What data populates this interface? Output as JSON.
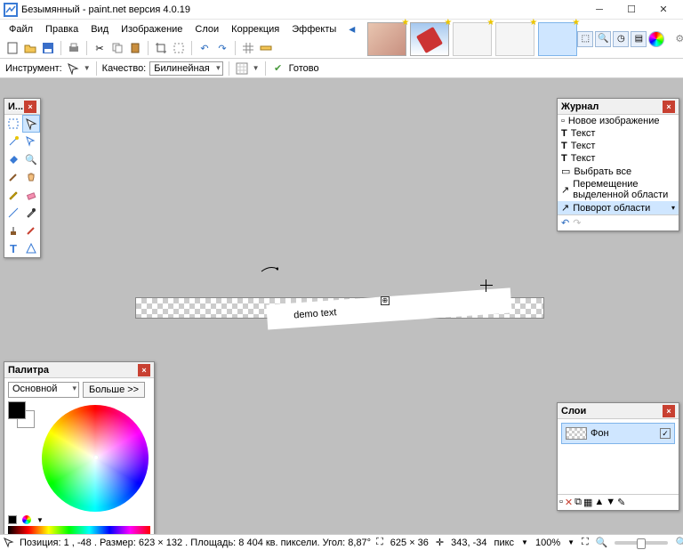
{
  "window": {
    "title": "Безымянный - paint.net версия 4.0.19"
  },
  "menu": {
    "file": "Файл",
    "edit": "Правка",
    "view": "Вид",
    "image": "Изображение",
    "layers": "Слои",
    "correction": "Коррекция",
    "effects": "Эффекты"
  },
  "toolbar3": {
    "tool_label": "Инструмент:",
    "quality_label": "Качество:",
    "quality_value": "Билинейная",
    "done": "Готово"
  },
  "tools_panel": {
    "title": "И..."
  },
  "history": {
    "title": "Журнал",
    "items": [
      "Новое изображение",
      "Текст",
      "Текст",
      "Текст",
      "Выбрать все",
      "Перемещение выделенной области",
      "Поворот области"
    ]
  },
  "colors": {
    "title": "Палитра",
    "primary": "Основной",
    "more": "Больше >>"
  },
  "layers": {
    "title": "Слои",
    "bg": "Фон"
  },
  "canvas": {
    "text": "demo text"
  },
  "status": {
    "pos": "Позиция: 1 , -48 . Размер: 623  × 132 . Площадь: 8 404 кв. пиксели. Угол: 8,87°",
    "size": "625 × 36",
    "cursor": "343, -34",
    "unit": "пикс",
    "zoom": "100%"
  }
}
